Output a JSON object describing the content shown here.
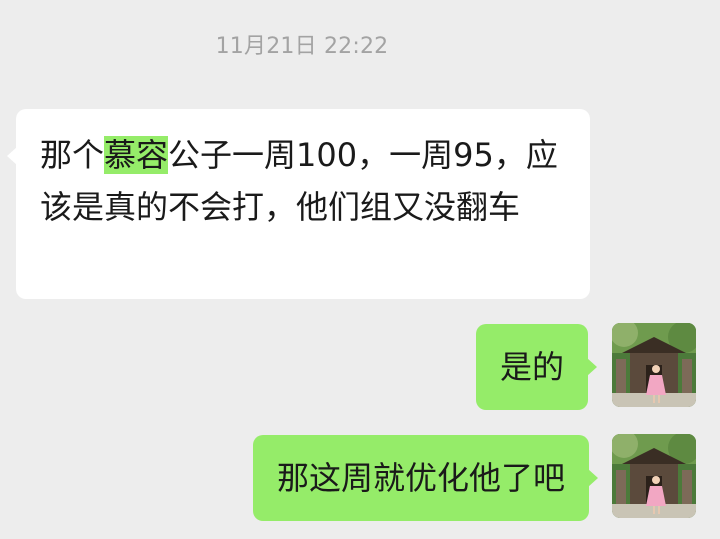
{
  "timestamp": "11月21日 22:22",
  "messages": {
    "incoming_1": {
      "before_highlight": "那个",
      "highlight": "慕容",
      "after_highlight": "公子一周100，一周95，应该是真的不会打，他们组又没翻车"
    },
    "outgoing_1": {
      "text": "是的"
    },
    "outgoing_2": {
      "text": "那这周就优化他了吧"
    }
  },
  "colors": {
    "background": "#ededed",
    "incoming_bubble": "#ffffff",
    "outgoing_bubble": "#95ec69",
    "highlight": "#95ec69",
    "timestamp_text": "#a3a3a3"
  },
  "icons": {
    "avatar": "user-avatar-photo"
  }
}
